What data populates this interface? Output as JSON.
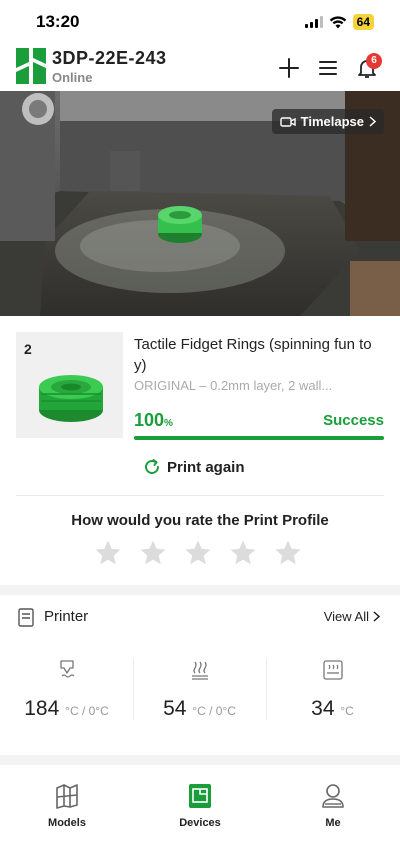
{
  "status_bar": {
    "time": "13:20",
    "battery": "64"
  },
  "header": {
    "device_name": "3DP-22E-243",
    "device_status": "Online",
    "notification_count": "6"
  },
  "camera": {
    "timelapse_label": "Timelapse"
  },
  "job": {
    "plate_number": "2",
    "title": "Tactile Fidget Rings (spinning fun toy)",
    "subtitle": "ORIGINAL – 0.2mm layer, 2 wall...",
    "progress_value": "100",
    "progress_unit": "%",
    "progress_fraction": 1.0,
    "status": "Success",
    "print_again_label": "Print again"
  },
  "rating": {
    "title": "How would you rate the Print Profile",
    "stars_total": 5,
    "stars_filled": 0
  },
  "printer": {
    "label": "Printer",
    "view_all_label": "View All",
    "temps": [
      {
        "icon": "nozzle-icon",
        "value": "184",
        "unit": "°C / 0°C"
      },
      {
        "icon": "heatbed-icon",
        "value": "54",
        "unit": "°C / 0°C"
      },
      {
        "icon": "chamber-icon",
        "value": "34",
        "unit": "°C"
      }
    ]
  },
  "nav": {
    "items": [
      {
        "label": "Models",
        "icon": "models-icon"
      },
      {
        "label": "Devices",
        "icon": "devices-icon",
        "active": true
      },
      {
        "label": "Me",
        "icon": "profile-icon"
      }
    ]
  },
  "colors": {
    "accent": "#1a9e3c",
    "badge": "#e53935",
    "battery": "#f5d33a"
  }
}
